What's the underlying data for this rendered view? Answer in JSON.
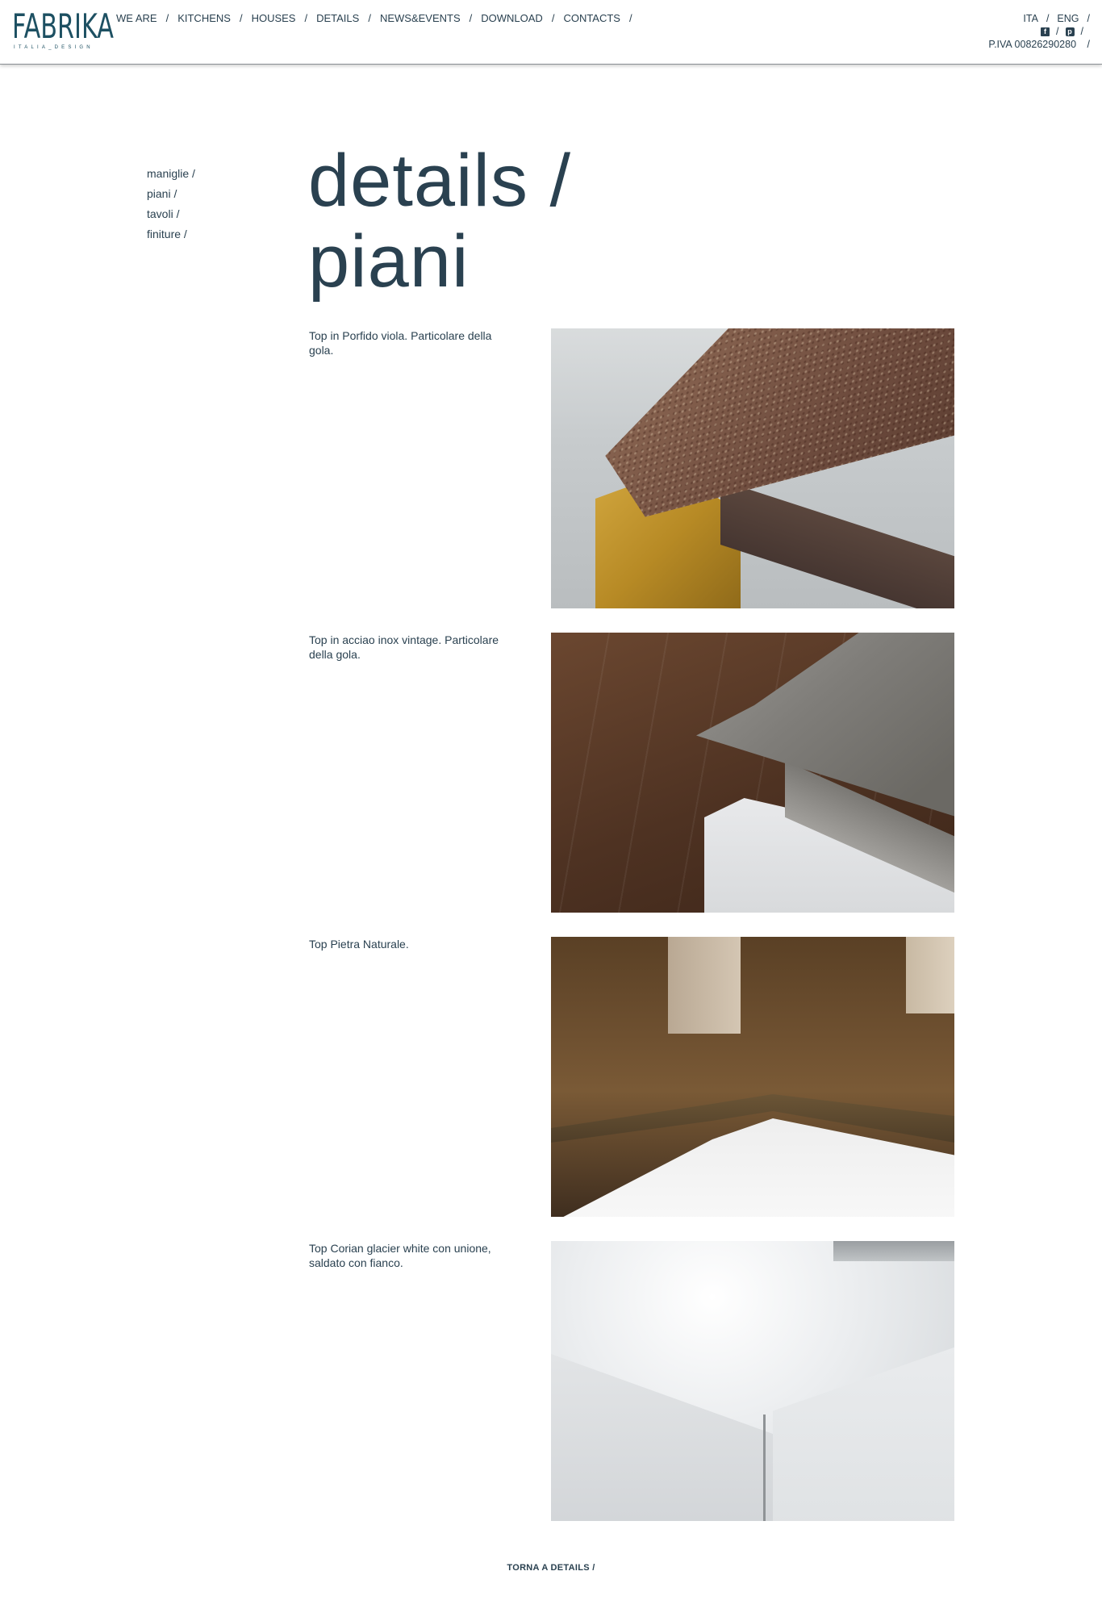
{
  "brand": {
    "name": "FABRIKA",
    "tagline": "ITALIA_DESIGN"
  },
  "nav": {
    "items": [
      {
        "label": "WE ARE"
      },
      {
        "label": "KITCHENS"
      },
      {
        "label": "HOUSES"
      },
      {
        "label": "DETAILS"
      },
      {
        "label": "NEWS&EVENTS"
      },
      {
        "label": "DOWNLOAD"
      },
      {
        "label": "CONTACTS"
      }
    ],
    "separator": "/"
  },
  "top_right": {
    "lang_ita": "ITA",
    "lang_eng": "ENG",
    "piva": "P.IVA 00826290280",
    "separator": "/",
    "facebook_icon": "f",
    "pinterest_icon": "p"
  },
  "side_nav": {
    "items": [
      {
        "label": "maniglie /"
      },
      {
        "label": "piani /"
      },
      {
        "label": "tavoli /"
      },
      {
        "label": "finiture /"
      }
    ]
  },
  "page": {
    "title_line1": "details /",
    "title_line2": "piani"
  },
  "items": [
    {
      "caption": "Top in Porfido viola. Particolare della gola."
    },
    {
      "caption": "Top in acciao inox vintage. Particolare della gola."
    },
    {
      "caption": "Top Pietra Naturale."
    },
    {
      "caption": "Top Corian glacier white con unione, saldato con fianco."
    }
  ],
  "footer": {
    "back_label": "TORNA A DETAILS /"
  },
  "colors": {
    "text": "#2a4150",
    "logo": "#1d5062",
    "background": "#ffffff"
  }
}
